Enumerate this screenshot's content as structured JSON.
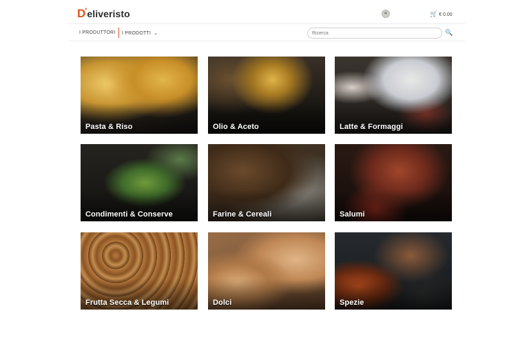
{
  "header": {
    "logo_initial": "D",
    "logo_rest": "eliveristo",
    "cart_total": "€ 0.00",
    "icons": {
      "user": "user-avatar-icon",
      "cart": "cart-icon",
      "search": "search-icon",
      "chevron": "chevron-down-icon"
    }
  },
  "nav": {
    "producers_label": "I PRODUTTORI",
    "products_label": "I PRODOTTI",
    "search_placeholder": "Ricerca"
  },
  "categories": [
    {
      "label": "Pasta & Riso"
    },
    {
      "label": "Olio & Aceto"
    },
    {
      "label": "Latte & Formaggi"
    },
    {
      "label": "Condimenti & Conserve"
    },
    {
      "label": "Farine & Cereali"
    },
    {
      "label": "Salumi"
    },
    {
      "label": "Frutta Secca & Legumi"
    },
    {
      "label": "Dolci"
    },
    {
      "label": "Spezie"
    }
  ],
  "colors": {
    "accent": "#e0541b",
    "text": "#444444",
    "border": "#ececec"
  }
}
